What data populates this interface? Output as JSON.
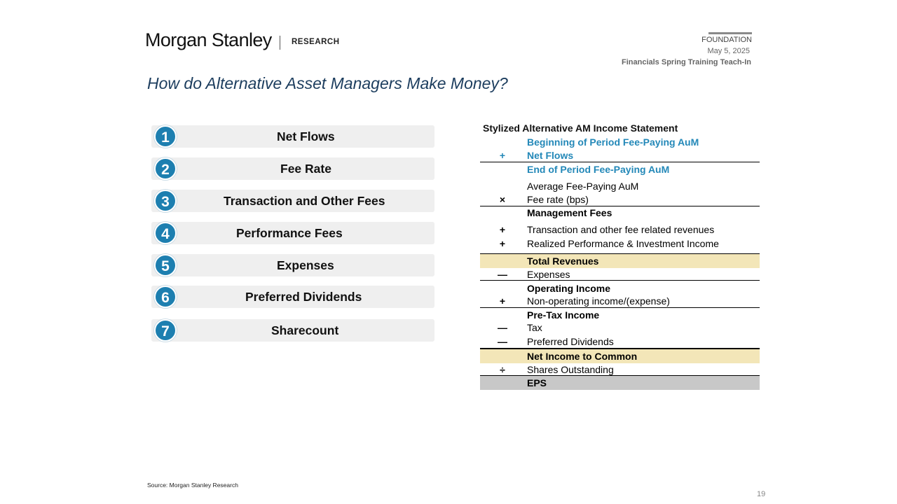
{
  "header": {
    "brand": "Morgan Stanley",
    "division": "RESEARCH",
    "report_type": "FOUNDATION",
    "date": "May 5, 2025",
    "event": "Financials Spring Training Teach-In"
  },
  "title": "How do Alternative Asset Managers Make Money?",
  "drivers": [
    {
      "number": "1",
      "label": "Net Flows"
    },
    {
      "number": "2",
      "label": "Fee Rate"
    },
    {
      "number": "3",
      "label": "Transaction and Other Fees"
    },
    {
      "number": "4",
      "label": "Performance Fees"
    },
    {
      "number": "5",
      "label": "Expenses"
    },
    {
      "number": "6",
      "label": "Preferred Dividends"
    },
    {
      "number": "7",
      "label": "Sharecount"
    }
  ],
  "statement": {
    "title": "Stylized Alternative AM Income Statement",
    "rows": [
      {
        "symbol": "",
        "label": "Beginning of Period Fee-Paying AuM"
      },
      {
        "symbol": "+",
        "label": "Net Flows"
      },
      {
        "symbol": "",
        "label": "End of Period Fee-Paying AuM"
      },
      {
        "symbol": "",
        "label": "Average Fee-Paying AuM"
      },
      {
        "symbol": "×",
        "label": "Fee rate (bps)"
      },
      {
        "symbol": "",
        "label": "Management Fees"
      },
      {
        "symbol": "+",
        "label": "Transaction and other fee related revenues"
      },
      {
        "symbol": "+",
        "label": "Realized Performance & Investment Income"
      },
      {
        "symbol": "",
        "label": "Total Revenues"
      },
      {
        "symbol": "—",
        "label": "Expenses"
      },
      {
        "symbol": "",
        "label": "Operating Income"
      },
      {
        "symbol": "+",
        "label": "Non-operating income/(expense)"
      },
      {
        "symbol": "",
        "label": "Pre-Tax Income"
      },
      {
        "symbol": "—",
        "label": "Tax"
      },
      {
        "symbol": "—",
        "label": "Preferred Dividends"
      },
      {
        "symbol": "",
        "label": "Net Income to Common"
      },
      {
        "symbol": "÷",
        "label": "Shares Outstanding"
      },
      {
        "symbol": "",
        "label": "EPS"
      }
    ]
  },
  "colors": {
    "title": "#1c3d5e",
    "badge": "#1d7fb0",
    "highlight_blue_text": "#2388b8",
    "highlight_row": "#f3e6b8",
    "eps_row": "#c8c8c8"
  },
  "footer": {
    "source": "Source: Morgan Stanley Research",
    "page": "19"
  }
}
